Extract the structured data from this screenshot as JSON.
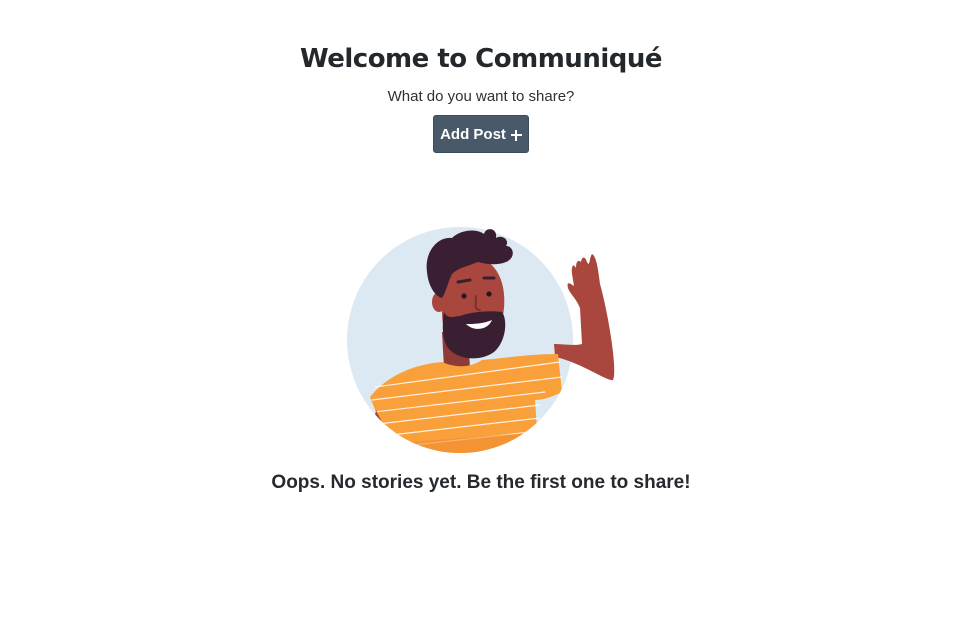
{
  "header": {
    "title": "Welcome to Communiqué",
    "subtitle": "What do you want to share?"
  },
  "actions": {
    "add_post_label": "Add Post",
    "add_post_icon": "plus-icon"
  },
  "empty_state": {
    "illustration": "waving-man-illustration",
    "message": "Oops. No stories yet. Be the first one to share!"
  },
  "colors": {
    "button_bg": "#485a69",
    "circle_bg": "#dde9f2",
    "shirt": "#f9a03b",
    "skin": "#a9473f",
    "hair": "#3a1f33",
    "text": "#23282d"
  }
}
